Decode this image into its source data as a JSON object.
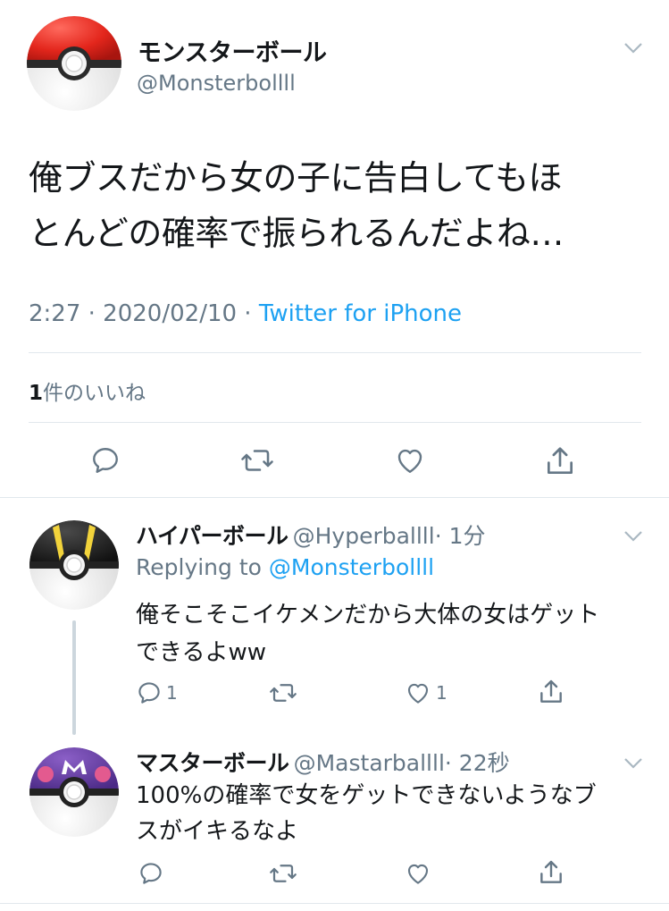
{
  "main_tweet": {
    "display_name": "モンスターボール",
    "handle": "@Monsterbollll",
    "text_line1": "俺ブスだから女の子に告白してもほ",
    "text_line2": "とんどの確率で振られるんだよね…",
    "time": "2:27 · 2020/02/10 · ",
    "source": "Twitter for iPhone",
    "likes_count": "1",
    "likes_label": "件のいいね"
  },
  "reply1": {
    "display_name": "ハイパーボール",
    "handle": "@Hyperballll",
    "time": "· 1分",
    "replying_prefix": "Replying to ",
    "replying_handle": "@Monsterbollll",
    "text_line1": "俺そこそこイケメンだから大体の女はゲット",
    "text_line2": "できるよww",
    "reply_count": "1",
    "like_count": "1"
  },
  "reply2": {
    "display_name": "マスターボール",
    "handle": "@Mastarballll",
    "time": "· 22秒",
    "text_line1": "100%の確率で女をゲットできないようなブ",
    "text_line2": "スがイキるなよ"
  },
  "icons": {
    "menu": "chevron-down-icon",
    "reply": "reply-icon",
    "retweet": "retweet-icon",
    "like": "heart-icon",
    "share": "share-icon"
  },
  "colors": {
    "link": "#1da1f2",
    "muted": "#657786",
    "divider": "#e1e8ed"
  }
}
